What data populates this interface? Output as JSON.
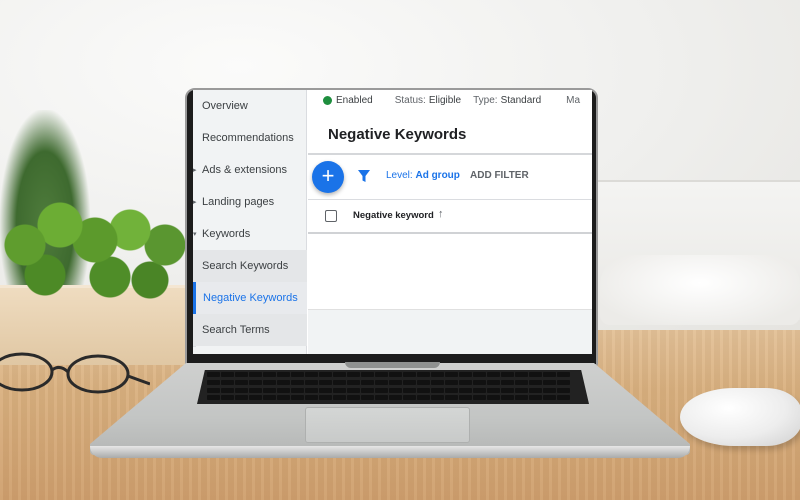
{
  "sidebar": {
    "items": [
      {
        "label": "Overview",
        "expandable": false
      },
      {
        "label": "Recommendations",
        "expandable": false
      },
      {
        "label": "Ads & extensions",
        "expandable": true
      },
      {
        "label": "Landing pages",
        "expandable": true
      },
      {
        "label": "Keywords",
        "expandable": true,
        "expanded": true
      },
      {
        "label": "Search Keywords",
        "sub": true
      },
      {
        "label": "Negative Keywords",
        "sub": true,
        "active": true
      },
      {
        "label": "Search Terms",
        "sub": true
      }
    ]
  },
  "status_bar": {
    "enabled": "Enabled",
    "status_label": "Status:",
    "status_value": "Eligible",
    "type_label": "Type:",
    "type_value": "Standard",
    "truncated": "Ma"
  },
  "page": {
    "title": "Negative Keywords"
  },
  "toolbar": {
    "add_icon": "plus-icon",
    "filter_icon": "filter-icon",
    "level_label": "Level:",
    "level_value": "Ad group",
    "add_filter": "ADD FILTER"
  },
  "table": {
    "column_header": "Negative keyword",
    "sort_icon": "arrow-up-icon"
  },
  "colors": {
    "accent": "#1a73e8",
    "enabled_dot": "#1e8e3e"
  }
}
